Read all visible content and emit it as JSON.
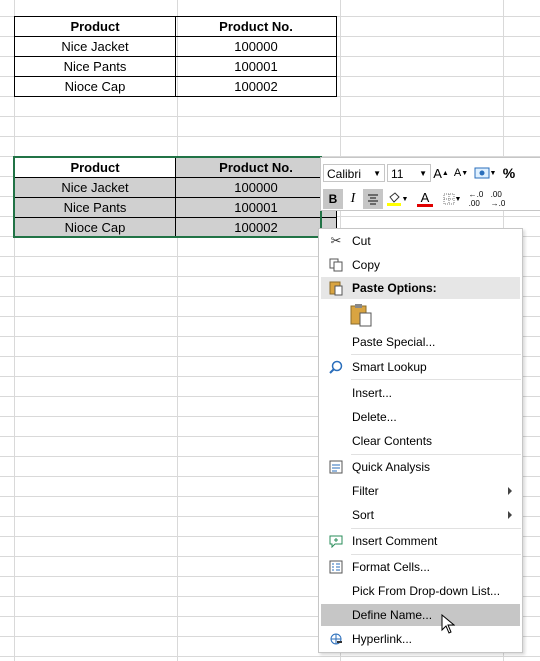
{
  "table1": {
    "headers": [
      "Product",
      "Product No."
    ],
    "rows": [
      [
        "Nice Jacket",
        "100000"
      ],
      [
        "Nice Pants",
        "100001"
      ],
      [
        "Nioce Cap",
        "100002"
      ]
    ]
  },
  "table2": {
    "headers": [
      "Product",
      "Product No."
    ],
    "rows": [
      [
        "Nice Jacket",
        "100000"
      ],
      [
        "Nice Pants",
        "100001"
      ],
      [
        "Nioce Cap",
        "100002"
      ]
    ]
  },
  "mini_toolbar": {
    "font": "Calibri",
    "size": "11",
    "grow": "A",
    "shrink": "A",
    "percent": "%",
    "bold": "B",
    "italic": "I",
    "font_color": "A"
  },
  "context_menu": {
    "cut": "Cut",
    "copy": "Copy",
    "paste_options": "Paste Options:",
    "paste_special": "Paste Special...",
    "smart_lookup": "Smart Lookup",
    "insert": "Insert...",
    "delete": "Delete...",
    "clear_contents": "Clear Contents",
    "quick_analysis": "Quick Analysis",
    "filter": "Filter",
    "sort": "Sort",
    "insert_comment": "Insert Comment",
    "format_cells": "Format Cells...",
    "pick_list": "Pick From Drop-down List...",
    "define_name": "Define Name...",
    "hyperlink": "Hyperlink..."
  }
}
